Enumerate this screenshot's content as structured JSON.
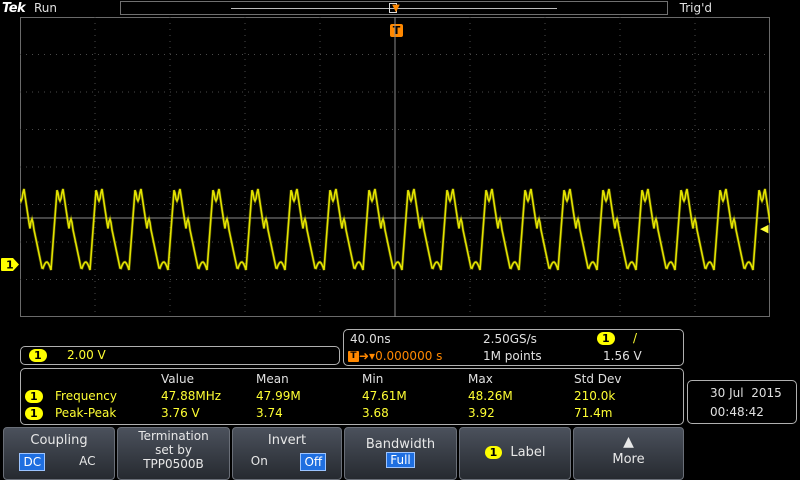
{
  "header": {
    "brand": "Tek",
    "acq_state": "Run",
    "trigger_status": "Trig'd",
    "trigger_icon": "T"
  },
  "channel1": {
    "badge": "1",
    "scale": "2.00 V",
    "color": "#ffff00"
  },
  "timebase": {
    "time_per_div": "40.0ns",
    "sample_rate": "2.50GS/s",
    "trigger_source_badge": "1",
    "trigger_slope": "/",
    "trigger_position": "0.000000 s",
    "record_length": "1M points",
    "trigger_level": "1.56 V"
  },
  "measurements": {
    "headers": [
      "Value",
      "Mean",
      "Min",
      "Max",
      "Std Dev"
    ],
    "rows": [
      {
        "badge": "1",
        "name": "Frequency",
        "values": [
          "47.88MHz",
          "47.99M",
          "47.61M",
          "48.26M",
          "210.0k"
        ]
      },
      {
        "badge": "1",
        "name": "Peak-Peak",
        "values": [
          "3.76 V",
          "3.74",
          "3.68",
          "3.92",
          "71.4m"
        ]
      }
    ]
  },
  "datetime": {
    "date": "30 Jul  2015",
    "time": "00:48:42"
  },
  "menu": {
    "coupling": {
      "title": "Coupling",
      "options": [
        "DC",
        "AC"
      ],
      "selected": "DC"
    },
    "termination": {
      "line1": "Termination",
      "line2": "set by",
      "line3": "TPP0500B"
    },
    "invert": {
      "title": "Invert",
      "options": [
        "On",
        "Off"
      ],
      "selected": "Off"
    },
    "bandwidth": {
      "title": "Bandwidth",
      "value": "Full"
    },
    "label": {
      "badge": "1",
      "title": "Label"
    },
    "more": {
      "title": "More",
      "icon": "up-arrow-icon"
    }
  },
  "colors": {
    "trace": "#ffff00",
    "trigger": "#ff8800",
    "selected_option": "#1f6fe0",
    "grid": "#707070"
  }
}
